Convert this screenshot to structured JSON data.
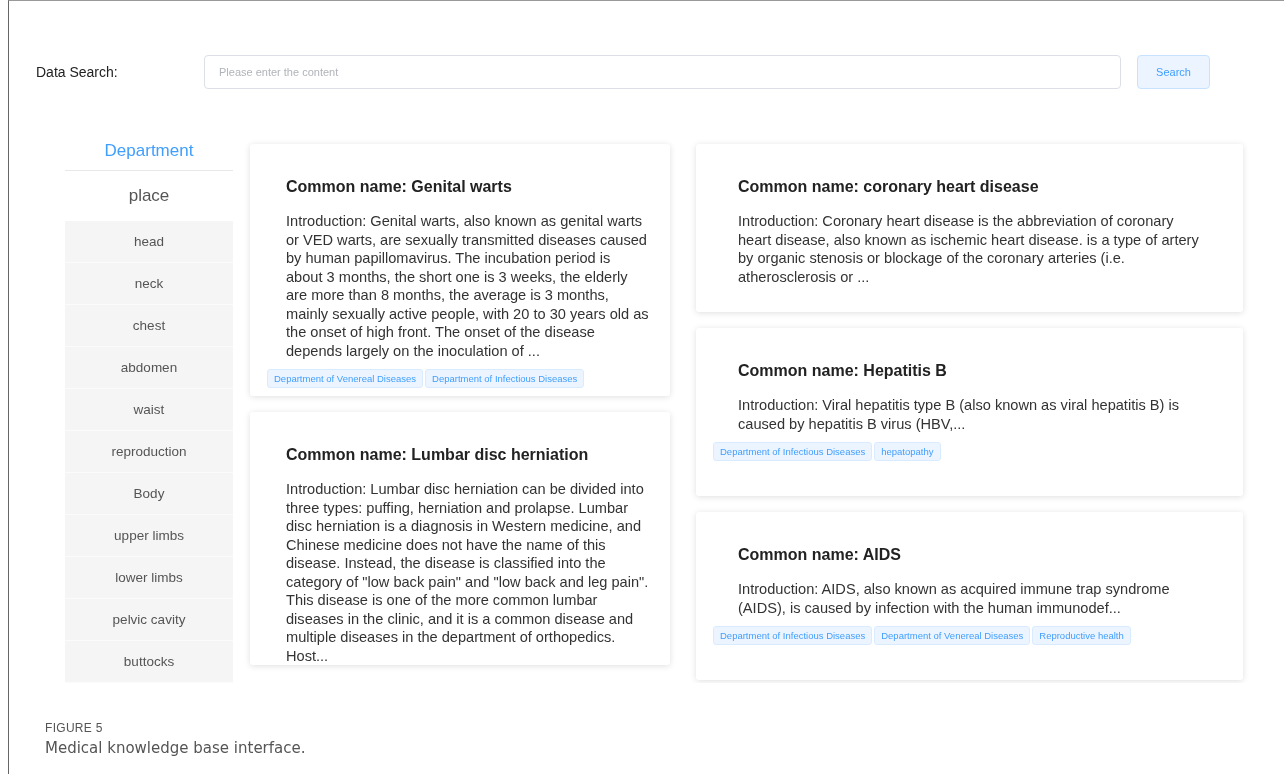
{
  "search": {
    "label": "Data Search:",
    "placeholder": "Please enter the content",
    "button": "Search"
  },
  "sidebar": {
    "tabs": [
      {
        "label": "Department",
        "selected": true
      },
      {
        "label": "place",
        "selected": false
      }
    ],
    "items": [
      "head",
      "neck",
      "chest",
      "abdomen",
      "waist",
      "reproduction",
      "Body",
      "upper limbs",
      "lower limbs",
      "pelvic cavity",
      "buttocks"
    ]
  },
  "columns": [
    [
      {
        "title": "Common name: Genital warts",
        "intro": "Introduction: Genital warts, also known as genital warts or VED warts, are sexually transmitted diseases caused by human papillomavirus. The incubation period is about 3 months, the short one is 3 weeks, the elderly are more than 8 months, the average is 3 months, mainly sexually active people, with 20 to 30 years old as the onset of high front. The onset of the disease depends largely on the inoculation of ...",
        "tags": [
          "Department of Venereal Diseases",
          "Department of Infectious Diseases"
        ]
      },
      {
        "title": "Common name: Lumbar disc herniation",
        "intro": "Introduction: Lumbar disc herniation can be divided into three types: puffing, herniation and prolapse. Lumbar disc herniation is a diagnosis in Western medicine, and Chinese medicine does not have the name of this disease. Instead, the disease is classified into the category of \"low back pain\" and \"low back and leg pain\". This disease is one of the more common lumbar diseases in the clinic, and it is a common disease and multiple diseases in the department of orthopedics. Host..."
      }
    ],
    [
      {
        "title": "Common name: coronary heart disease",
        "intro": "Introduction: Coronary heart disease is the abbreviation of coronary heart disease, also known as ischemic heart disease. is a type of artery by organic stenosis or blockage of the coronary arteries (i.e. atherosclerosis or ..."
      },
      {
        "title": "Common name: Hepatitis B",
        "intro": "Introduction: Viral hepatitis type B (also known as viral hepatitis B) is caused by hepatitis B virus (HBV,...",
        "tags": [
          "Department of Infectious Diseases",
          "hepatopathy"
        ]
      },
      {
        "title": "Common name: AIDS",
        "intro": "Introduction: AIDS, also known as acquired immune trap syndrome (AIDS), is caused by infection with the human immunodef...",
        "tags": [
          "Department of Infectious Diseases",
          "Department of Venereal Diseases",
          "Reproductive health"
        ]
      }
    ]
  ],
  "caption": {
    "label": "FIGURE 5",
    "text": "Medical knowledge base interface."
  }
}
